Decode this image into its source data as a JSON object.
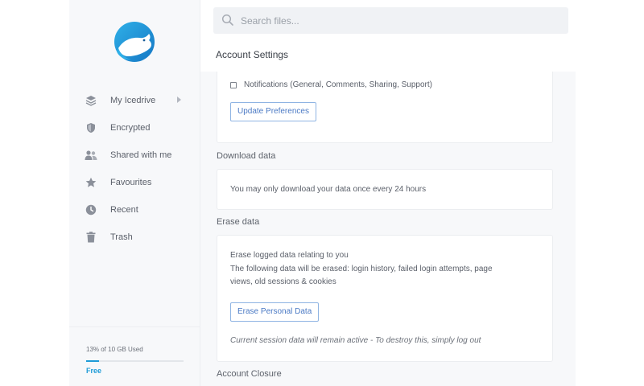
{
  "colors": {
    "accent": "#1e9bd7",
    "button_text": "#4a79c4",
    "button_border": "#8fb4e3"
  },
  "sidebar": {
    "logo_icon": "polar-bear-logo",
    "items": [
      {
        "label": "My Icedrive",
        "icon": "layers-icon",
        "has_submenu": true
      },
      {
        "label": "Encrypted",
        "icon": "shield-icon"
      },
      {
        "label": "Shared with me",
        "icon": "users-icon"
      },
      {
        "label": "Favourites",
        "icon": "star-icon"
      },
      {
        "label": "Recent",
        "icon": "clock-icon"
      },
      {
        "label": "Trash",
        "icon": "trash-icon"
      }
    ],
    "storage": {
      "text": "13% of 10 GB Used",
      "used_fraction": 0.13,
      "plan": "Free"
    }
  },
  "search": {
    "placeholder": "Search files..."
  },
  "page": {
    "title": "Account Settings",
    "notifications": {
      "checkbox_label": "Notifications (General, Comments, Sharing, Support)",
      "checked": false,
      "button": "Update Preferences"
    },
    "download": {
      "title": "Download data",
      "text": "You may only download your data once every 24 hours"
    },
    "erase": {
      "title": "Erase data",
      "line1": "Erase logged data relating to you",
      "line2": "The following data will be erased: login history, failed login attempts, page",
      "line3": "views, old sessions & cookies",
      "button": "Erase Personal Data",
      "note": "Current session data will remain active - To destroy this, simply log out"
    },
    "closure": {
      "title": "Account Closure"
    }
  }
}
